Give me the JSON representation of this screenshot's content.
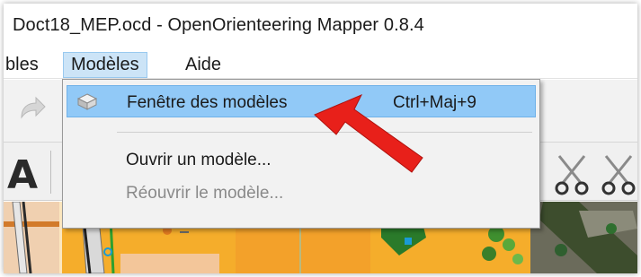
{
  "window": {
    "title": "Doct18_MEP.ocd - OpenOrienteering Mapper 0.8.4"
  },
  "menubar": {
    "items": [
      {
        "label": "bles"
      },
      {
        "label": "Modèles"
      },
      {
        "label": "Aide"
      }
    ]
  },
  "toolbar": {
    "text_tool_glyph": "A"
  },
  "dropdown": {
    "items": [
      {
        "label": "Fenêtre des modèles",
        "shortcut": "Ctrl+Maj+9",
        "icon": "templates-icon",
        "highlighted": true,
        "enabled": true
      },
      {
        "label": "Ouvrir un modèle...",
        "enabled": true
      },
      {
        "label": "Réouvrir le modèle...",
        "enabled": false
      }
    ]
  },
  "annotation": {
    "arrow_color": "#e8201a"
  },
  "colors": {
    "menu_highlight": "#91c9f7",
    "map_orange": "#f5ad2b"
  }
}
